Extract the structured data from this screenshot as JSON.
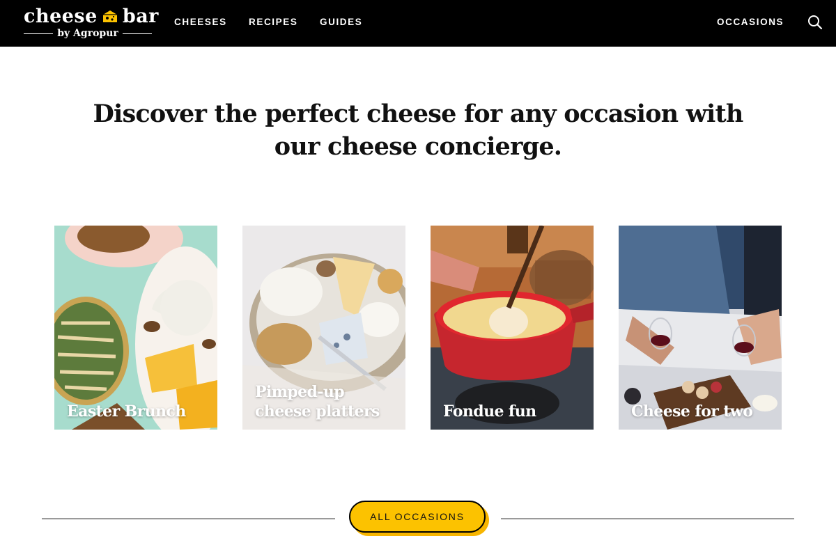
{
  "brand": {
    "name_word1": "cheese",
    "name_word2": "bar",
    "tagline": "by Agropur",
    "icon": "cheese-wedge-icon",
    "accent_color": "#fcc200"
  },
  "nav": {
    "items": [
      {
        "label": "CHEESES"
      },
      {
        "label": "RECIPES"
      },
      {
        "label": "GUIDES"
      }
    ],
    "right_item": "OCCASIONS",
    "search_icon": "search-icon"
  },
  "hero": {
    "headline": "Discover the perfect cheese for any occasion with our cheese concierge."
  },
  "occasions": [
    {
      "label": "Easter Brunch"
    },
    {
      "label": "Pimped-up\ncheese platters"
    },
    {
      "label": "Fondue fun"
    },
    {
      "label": "Cheese for two"
    }
  ],
  "cta": {
    "label": "ALL OCCASIONS"
  },
  "colors": {
    "header_bg": "#000000",
    "page_bg": "#ffffff",
    "cta_bg": "#fcc200",
    "divider": "#9a9a9a"
  }
}
